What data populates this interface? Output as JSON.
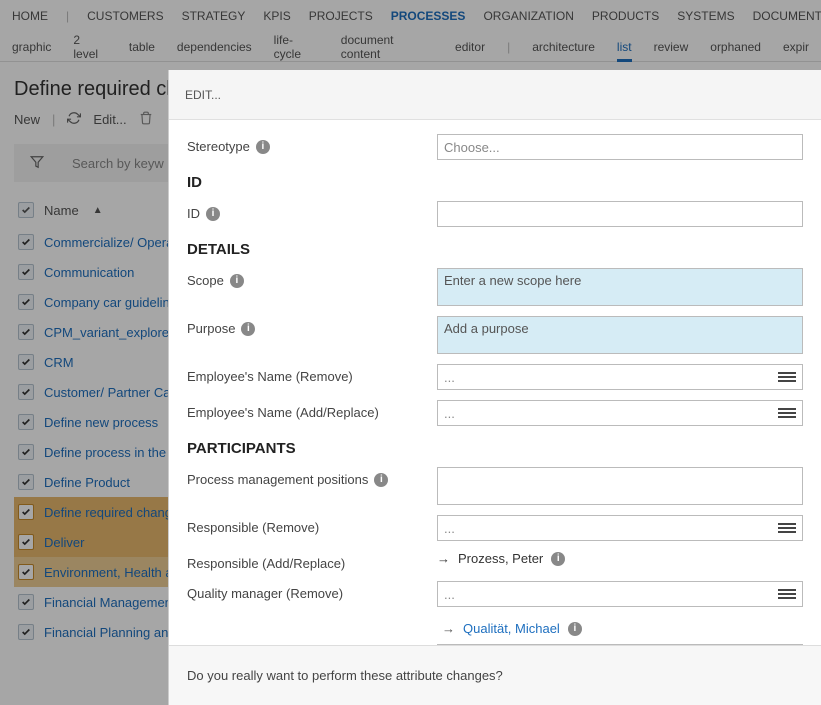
{
  "nav_primary": [
    "HOME",
    "|",
    "CUSTOMERS",
    "STRATEGY",
    "KPIS",
    "PROJECTS",
    "PROCESSES",
    "ORGANIZATION",
    "PRODUCTS",
    "SYSTEMS",
    "DOCUMENTS"
  ],
  "nav_primary_active": 6,
  "nav_secondary": [
    "graphic",
    "2 level",
    "table",
    "dependencies",
    "life-cycle",
    "document content",
    "editor",
    "|",
    "architecture",
    "list",
    "review",
    "orphaned",
    "expir"
  ],
  "nav_secondary_active": 9,
  "page_title": "Define required chan",
  "toolbar": {
    "new": "New",
    "edit": "Edit..."
  },
  "search_placeholder": "Search by keyw",
  "column_header": "Name",
  "rows": [
    {
      "label": "Commercialize/ Operat",
      "checked": false
    },
    {
      "label": "Communication",
      "checked": false
    },
    {
      "label": "Company car guideline",
      "checked": false
    },
    {
      "label": "CPM_variant_explorer",
      "checked": false
    },
    {
      "label": "CRM",
      "checked": false
    },
    {
      "label": "Customer/ Partner Care",
      "checked": false
    },
    {
      "label": "Define new process",
      "checked": false
    },
    {
      "label": "Define process in the a",
      "checked": false
    },
    {
      "label": "Define Product",
      "checked": false
    },
    {
      "label": "Define required change",
      "checked": true
    },
    {
      "label": "Deliver",
      "checked": true
    },
    {
      "label": "Environment, Health an",
      "checked": true
    },
    {
      "label": "Financial Management",
      "checked": false
    },
    {
      "label": "Financial Planning and",
      "checked": false
    }
  ],
  "panel": {
    "title": "EDIT...",
    "stereotype_label": "Stereotype",
    "stereotype_placeholder": "Choose...",
    "section_id": "ID",
    "id_label": "ID",
    "section_details": "DETAILS",
    "scope_label": "Scope",
    "scope_placeholder": "Enter a new scope here",
    "purpose_label": "Purpose",
    "purpose_placeholder": "Add a purpose",
    "emp_remove": "Employee's Name (Remove)",
    "emp_add": "Employee's Name (Add/Replace)",
    "dots": "...",
    "section_participants": "PARTICIPANTS",
    "pmp_label": "Process management positions",
    "resp_remove": "Responsible (Remove)",
    "resp_add": "Responsible (Add/Replace)",
    "resp_value": "Prozess, Peter",
    "qm_remove": "Quality manager (Remove)",
    "qm_value": "Qualität, Michael",
    "confirm": "Do you really want to perform these attribute changes?"
  }
}
